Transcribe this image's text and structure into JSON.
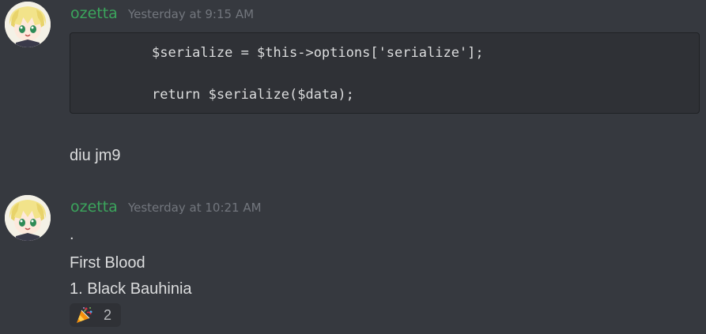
{
  "messages": [
    {
      "author": "ozetta",
      "timestamp": "Yesterday at 9:15 AM",
      "code_lines": [
        "$serialize = $this->options['serialize'];",
        "return $serialize($data);"
      ],
      "text": "diu jm9"
    },
    {
      "author": "ozetta",
      "timestamp": "Yesterday at 10:21 AM",
      "lines": [
        ".",
        "First Blood",
        "1. Black Bauhinia"
      ],
      "reaction": {
        "emoji": "party-popper-icon",
        "count": "2"
      }
    }
  ],
  "colors": {
    "background": "#36393f",
    "username": "#3ba55c",
    "timestamp": "#72767d",
    "text": "#dcddde",
    "code_background": "#2f3136"
  }
}
